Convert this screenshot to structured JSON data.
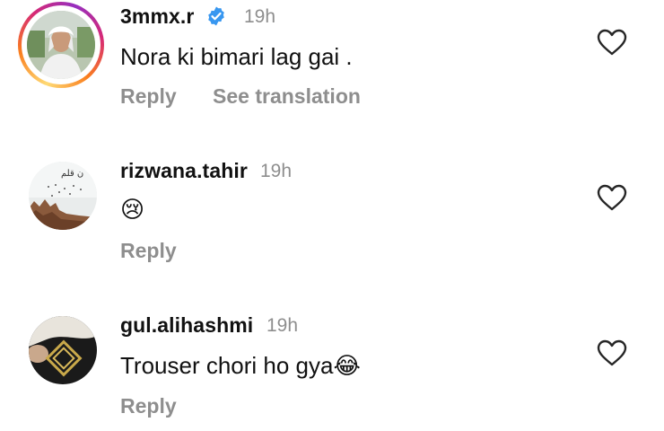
{
  "comments": [
    {
      "username": "3mmx.r",
      "time": "19h",
      "verified": true,
      "text": "Nora ki bimari lag gai .",
      "actions": [
        "Reply",
        "See translation"
      ],
      "like_icon": "heart-outline-icon"
    },
    {
      "username": "rizwana.tahir",
      "time": "19h",
      "verified": false,
      "text": "😢",
      "actions": [
        "Reply"
      ],
      "like_icon": "heart-outline-icon"
    },
    {
      "username": "gul.alihashmi",
      "time": "19h",
      "verified": false,
      "text": "Trouser chori ho gya😂",
      "actions": [
        "Reply"
      ],
      "like_icon": "heart-outline-icon"
    }
  ],
  "colors": {
    "secondary_text": "#8e8e8e",
    "verified_badge": "#3897f0",
    "story_ring": [
      "#feda75",
      "#fa7e1e",
      "#d62976",
      "#962fbf"
    ]
  }
}
